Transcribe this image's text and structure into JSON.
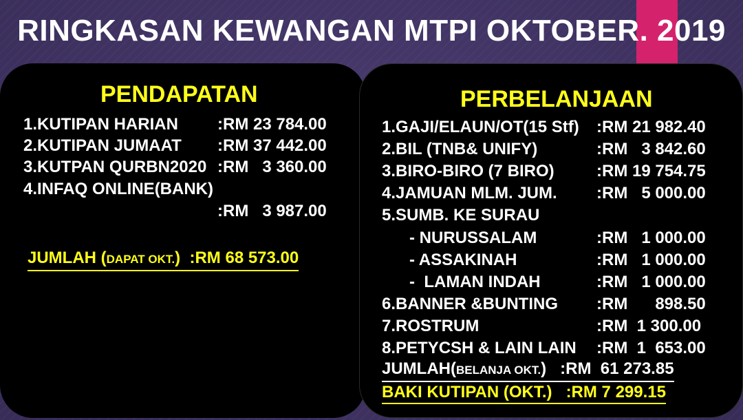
{
  "title": "RINGKASAN KEWANGAN MTPI OKTOBER. 2019",
  "colors": {
    "background": "#3f3363",
    "accent": "#d4226d",
    "panel": "#000000",
    "heading": "#ffff1a",
    "text": "#ffffff"
  },
  "pendapatan": {
    "heading": "PENDAPATAN",
    "items": [
      {
        "label": "1.KUTIPAN HARIAN",
        "amount": ":RM 23 784.00"
      },
      {
        "label": "2.KUTIPAN JUMAAT",
        "amount": ":RM 37 442.00"
      },
      {
        "label": "3.KUTPAN QURBN2020",
        "amount": ":RM   3 360.00"
      },
      {
        "label": "4.INFAQ ONLINE(BANK)",
        "amount": ":RM   3 987.00"
      }
    ],
    "total_label": "JUMLAH (",
    "total_label_small": "DAPAT OKT.",
    "total_label_end": ")",
    "total_amount": ":RM 68 573.00"
  },
  "perbelanjaan": {
    "heading": "PERBELANJAAN",
    "items": [
      {
        "label": "1.GAJI/ELAUN/OT(15 Stf)",
        "amount": ":RM 21 982.40"
      },
      {
        "label": "2.BIL (TNB& UNIFY)",
        "amount": ":RM   3 842.60"
      },
      {
        "label": "3.BIRO-BIRO (7 BIRO)",
        "amount": ":RM 19 754.75"
      },
      {
        "label": "4.JAMUAN MLM. JUM.",
        "amount": ":RM   5 000.00"
      },
      {
        "label": "5.SUMB. KE SURAU",
        "amount": ""
      },
      {
        "label": "- NURUSSALAM",
        "amount": ":RM   1 000.00"
      },
      {
        "label": "- ASSAKINAH",
        "amount": ":RM   1 000.00"
      },
      {
        "label": "-  LAMAN INDAH",
        "amount": ":RM   1 000.00"
      },
      {
        "label": "6.BANNER &BUNTING",
        "amount": ":RM      898.50"
      },
      {
        "label": "7.ROSTRUM",
        "amount": ":RM  1 300.00"
      },
      {
        "label": "8.PETYCSH & LAIN LAIN",
        "amount": ":RM  1  653.00"
      }
    ],
    "total_label": "JUMLAH(",
    "total_label_small": "BELANJA OKT.",
    "total_label_end": ")",
    "total_amount": ":RM  61 273.85",
    "balance_label": "BAKI KUTIPAN (OKT.)",
    "balance_amount": ":RM 7 299.15"
  }
}
